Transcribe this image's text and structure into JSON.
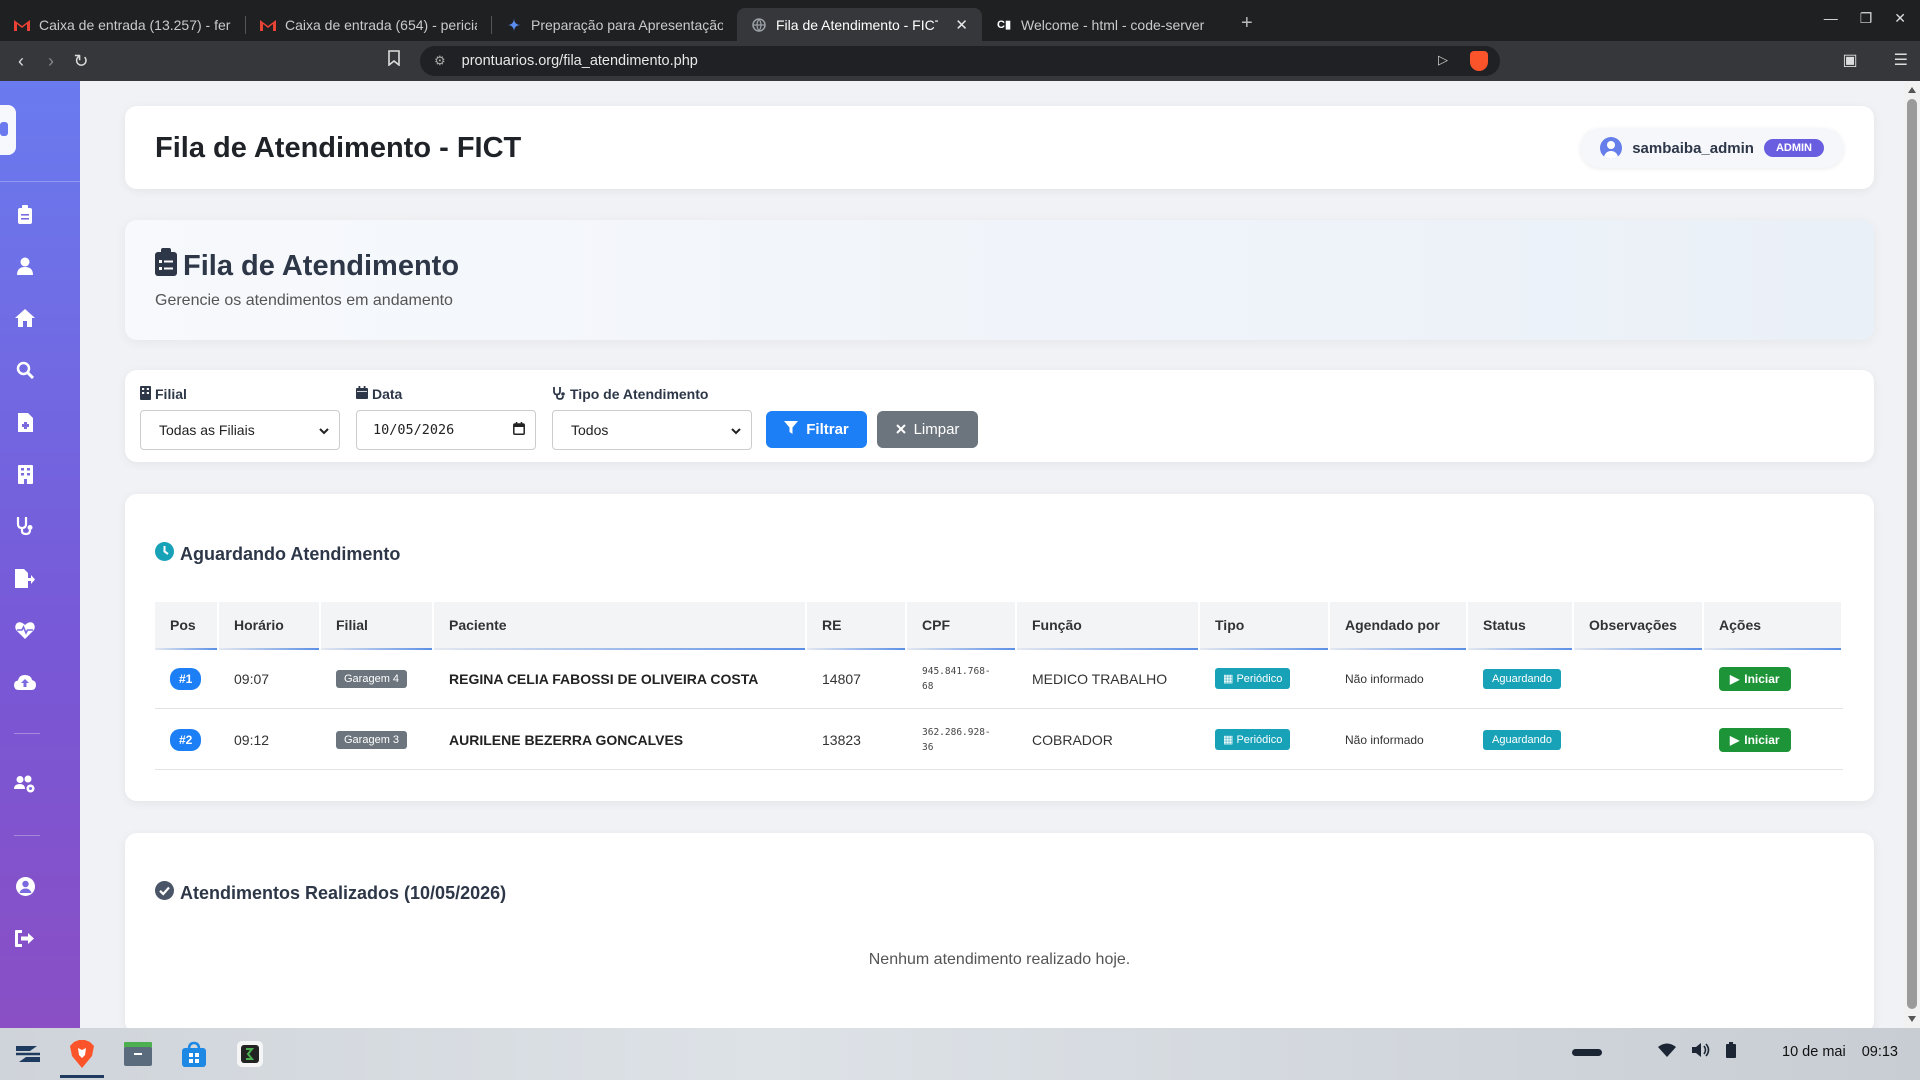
{
  "browser": {
    "tabs": [
      {
        "title": "Caixa de entrada (13.257) - fern",
        "icon": "gmail-icon",
        "active": false
      },
      {
        "title": "Caixa de entrada (654) - pericia",
        "icon": "gmail-icon",
        "active": false
      },
      {
        "title": "Preparação para Apresentação",
        "icon": "gemini-icon",
        "active": false
      },
      {
        "title": "Fila de Atendimento - FICT",
        "icon": "globe-icon",
        "active": true
      },
      {
        "title": "Welcome - html - code-server",
        "icon": "code-server-icon",
        "active": false
      }
    ],
    "url": "prontuarios.org/fila_atendimento.php"
  },
  "header": {
    "title": "Fila de Atendimento - FICT",
    "user": "sambaiba_admin",
    "role": "ADMIN"
  },
  "page": {
    "title": "Fila de Atendimento",
    "subtitle": "Gerencie os atendimentos em andamento"
  },
  "filters": {
    "filial_label": "Filial",
    "filial_value": "Todas as Filiais",
    "data_label": "Data",
    "data_value": "10/05/2026",
    "tipo_label": "Tipo de Atendimento",
    "tipo_value": "Todos",
    "filter_button": "Filtrar",
    "clear_button": "Limpar"
  },
  "queue": {
    "title": "Aguardando Atendimento",
    "columns": [
      "Pos",
      "Horário",
      "Filial",
      "Paciente",
      "RE",
      "CPF",
      "Função",
      "Tipo",
      "Agendado por",
      "Status",
      "Observações",
      "Ações"
    ],
    "rows": [
      {
        "pos": "#1",
        "horario": "09:07",
        "filial": "Garagem 4",
        "paciente": "REGINA CELIA FABOSSI DE OLIVEIRA COSTA",
        "re": "14807",
        "cpf": "945.841.768-68",
        "funcao": "MEDICO TRABALHO",
        "tipo": "Periódico",
        "agendado": "Não informado",
        "status": "Aguardando",
        "obs": "",
        "acao": "Iniciar"
      },
      {
        "pos": "#2",
        "horario": "09:12",
        "filial": "Garagem 3",
        "paciente": "AURILENE BEZERRA GONCALVES",
        "re": "13823",
        "cpf": "362.286.928-36",
        "funcao": "COBRADOR",
        "tipo": "Periódico",
        "agendado": "Não informado",
        "status": "Aguardando",
        "obs": "",
        "acao": "Iniciar"
      }
    ]
  },
  "done": {
    "title": "Atendimentos Realizados (10/05/2026)",
    "empty": "Nenhum atendimento realizado hoje."
  },
  "taskbar": {
    "clock_date": "10 de mai",
    "clock_time": "09:13"
  },
  "colors": {
    "primary": "#1d7ff5",
    "secondary": "#6c757d",
    "info": "#18a2b8",
    "success": "#1e9438",
    "sidebar_top": "#6a7bef",
    "sidebar_bottom": "#8a4fc4"
  }
}
